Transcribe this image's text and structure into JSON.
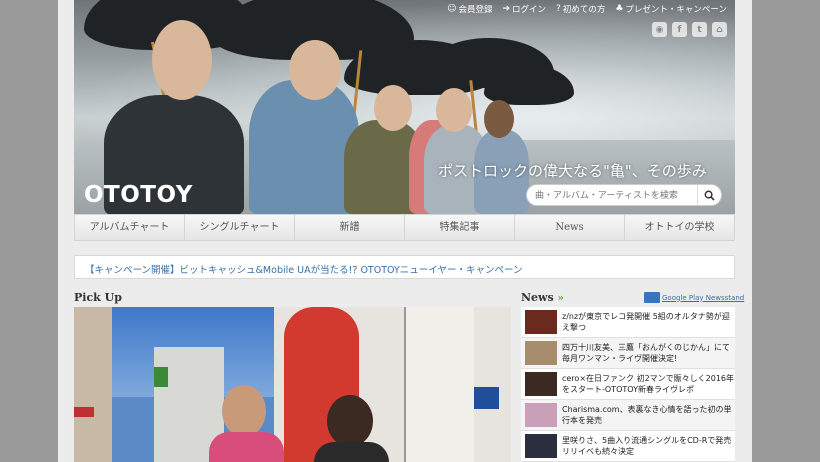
{
  "header": {
    "top_links": [
      {
        "icon": "smile-icon",
        "label": "会員登録"
      },
      {
        "icon": "login-icon",
        "label": "ログイン"
      },
      {
        "icon": "help-icon",
        "label": "初めての方"
      },
      {
        "icon": "gift-icon",
        "label": "プレゼント・キャンペーン"
      }
    ],
    "social": [
      {
        "icon": "rss-icon",
        "glyph": "◉"
      },
      {
        "icon": "facebook-icon",
        "glyph": "f"
      },
      {
        "icon": "twitter-icon",
        "glyph": "t"
      },
      {
        "icon": "home-icon",
        "glyph": "⌂"
      }
    ],
    "logo": "OTOTOY",
    "tagline": "ポストロックの偉大なる\"亀\"、その歩み",
    "search_placeholder": "曲・アルバム・アーティストを検索"
  },
  "nav": [
    "アルバムチャート",
    "シングルチャート",
    "新譜",
    "特集記事",
    "News",
    "オトトイの学校"
  ],
  "campaign": "【キャンペーン開催】ビットキャッシュ&Mobile UAが当たる!? OTOTOYニューイヤー・キャンペーン",
  "pickup": {
    "title": "Pick Up"
  },
  "news": {
    "title": "News",
    "arrow": "»",
    "google_play": "Google Play Newsstand",
    "items": [
      {
        "text": "z/nzが東京でレコ発開催 5組のオルタナ勢が迎え撃つ",
        "color": "#6a2a1e"
      },
      {
        "text": "四万十川友美、三鷹「おんがくのじかん」にて毎月ワンマン・ライヴ開催決定!",
        "color": "#a88c6e"
      },
      {
        "text": "cero×在日ファンク 初2マンで賑々しく2016年をスタート-OTOTOY新春ライヴレポ",
        "color": "#3a2a22"
      },
      {
        "text": "Charisma.com、表裏なき心情を語った初の単行本を発売",
        "color": "#c9a0b8"
      },
      {
        "text": "里咲りさ、5曲入り流通シングルをCD-Rで発売 リリイベも続々決定",
        "color": "#2a2e3e"
      }
    ]
  }
}
